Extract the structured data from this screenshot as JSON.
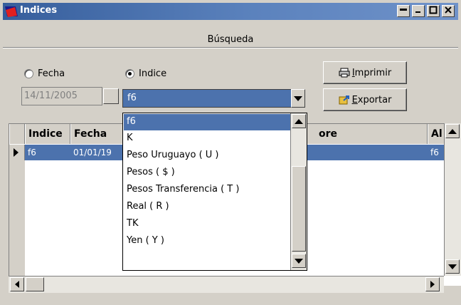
{
  "window": {
    "title": "Indices"
  },
  "search": {
    "header": "Búsqueda",
    "radio_fecha": "Fecha",
    "radio_indice": "Indice",
    "selected_radio": "Indice",
    "date_value": "14/11/2005",
    "combo_value": "f6"
  },
  "buttons": {
    "print_label": "mprimir",
    "print_mnemonic": "I",
    "export_label": "xportar",
    "export_mnemonic": "E"
  },
  "grid": {
    "columns": [
      "Indice",
      "Fecha",
      "ore",
      "Al"
    ],
    "rows": [
      {
        "indice": "f6",
        "fecha": "01/01/19",
        "al": "f6"
      }
    ]
  },
  "dropdown": {
    "items": [
      "f6",
      "K",
      "Peso Uruguayo ( U )",
      "Pesos ( $ )",
      "Pesos Transferencia ( T )",
      "Real ( R )",
      "TK",
      "Yen ( Y )"
    ],
    "selected": "f6"
  },
  "colors": {
    "title_gradient_start": "#365e9c",
    "selection": "#4c72ad",
    "face": "#d4d0c8"
  }
}
